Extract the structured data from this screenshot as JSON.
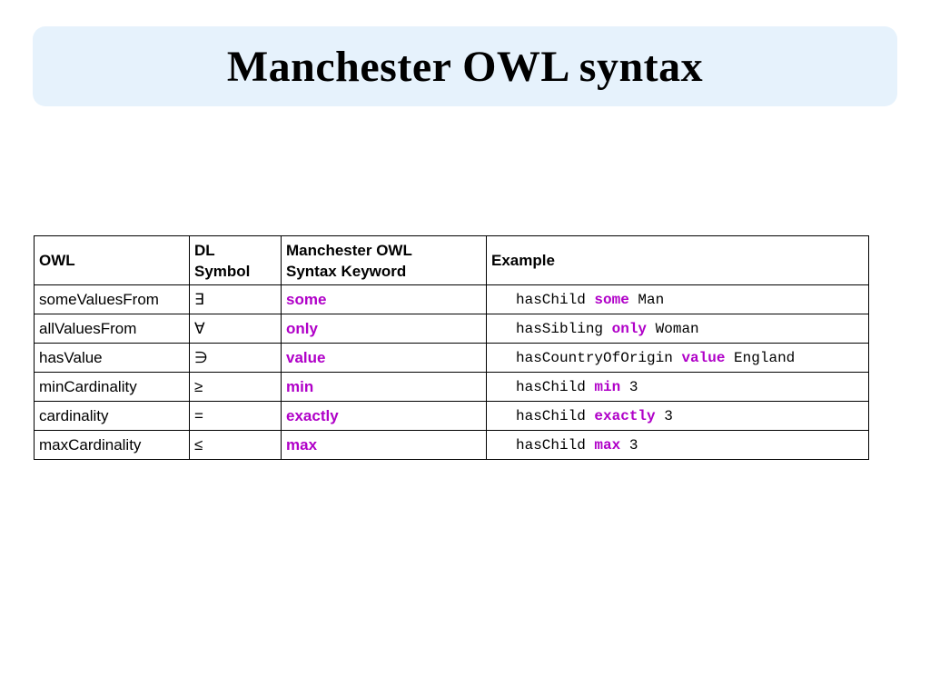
{
  "title": "Manchester OWL syntax",
  "table": {
    "headers": {
      "owl": "OWL",
      "dl_line1": "DL",
      "dl_line2": "Symbol",
      "kw_line1": "Manchester OWL",
      "kw_line2": "Syntax Keyword",
      "example": "Example"
    },
    "rows": [
      {
        "owl": "someValuesFrom",
        "dl": "∃",
        "keyword": "some",
        "example": {
          "pre": "hasChild ",
          "kw": "some",
          "post": " Man"
        }
      },
      {
        "owl": "allValuesFrom",
        "dl": "∀",
        "keyword": "only",
        "example": {
          "pre": "hasSibling ",
          "kw": "only",
          "post": " Woman"
        }
      },
      {
        "owl": "hasValue",
        "dl": "∋",
        "keyword": "value",
        "example": {
          "pre": "hasCountryOfOrigin ",
          "kw": "value",
          "post": " England"
        }
      },
      {
        "owl": "minCardinality",
        "dl": "≥",
        "keyword": "min",
        "example": {
          "pre": "hasChild ",
          "kw": "min",
          "post": " 3"
        }
      },
      {
        "owl": "cardinality",
        "dl": "=",
        "keyword": "exactly",
        "example": {
          "pre": "hasChild ",
          "kw": "exactly",
          "post": " 3"
        }
      },
      {
        "owl": "maxCardinality",
        "dl": "≤",
        "keyword": "max",
        "example": {
          "pre": "hasChild ",
          "kw": "max",
          "post": " 3"
        }
      }
    ]
  },
  "colors": {
    "banner_bg": "#e6f2fc",
    "keyword": "#b000c8"
  }
}
